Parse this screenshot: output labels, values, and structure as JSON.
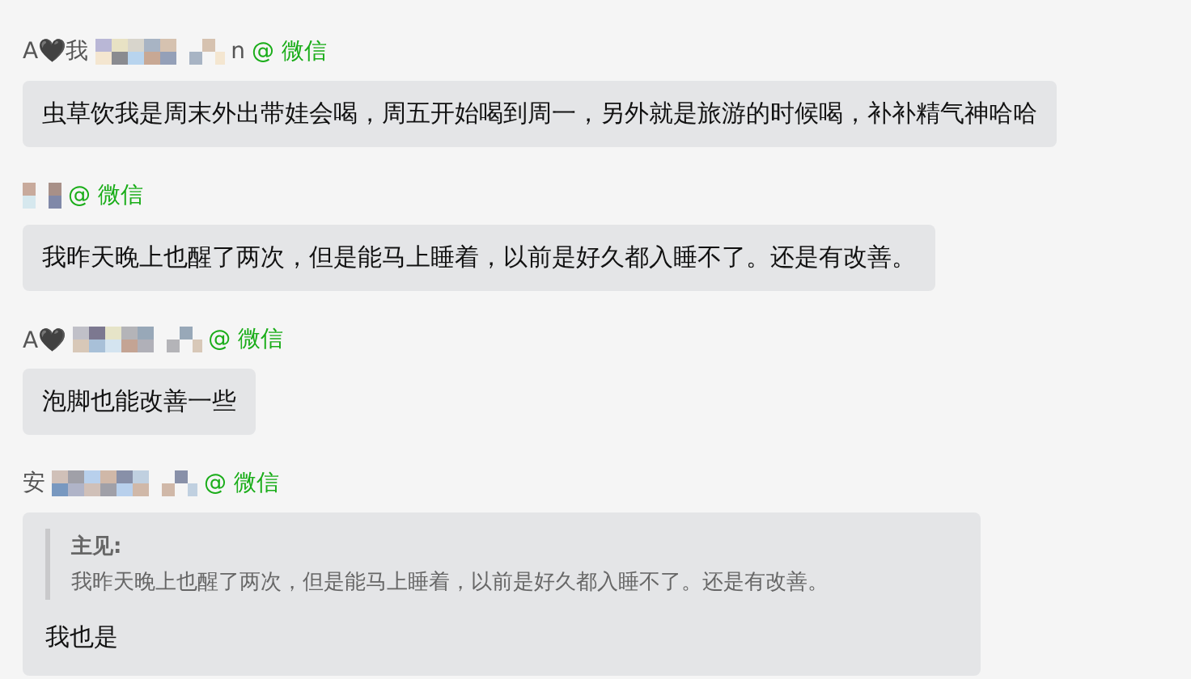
{
  "messages": [
    {
      "sender_prefix": "A🖤我",
      "sender_suffix": "n",
      "source": "@ 微信",
      "text": "虫草饮我是周末外出带娃会喝，周五开始喝到周一，另外就是旅游的时候喝，补补精气神哈哈"
    },
    {
      "source": "@ 微信",
      "text": "我昨天晚上也醒了两次，但是能马上睡着，以前是好久都入睡不了。还是有改善。"
    },
    {
      "sender_prefix": "A🖤",
      "source": "@ 微信",
      "text": "泡脚也能改善一些"
    },
    {
      "sender_prefix": "安",
      "source": "@ 微信",
      "quote": {
        "author": "主见:",
        "text": "我昨天晚上也醒了两次，但是能马上睡着，以前是好久都入睡不了。还是有改善。"
      },
      "text": "我也是"
    }
  ]
}
